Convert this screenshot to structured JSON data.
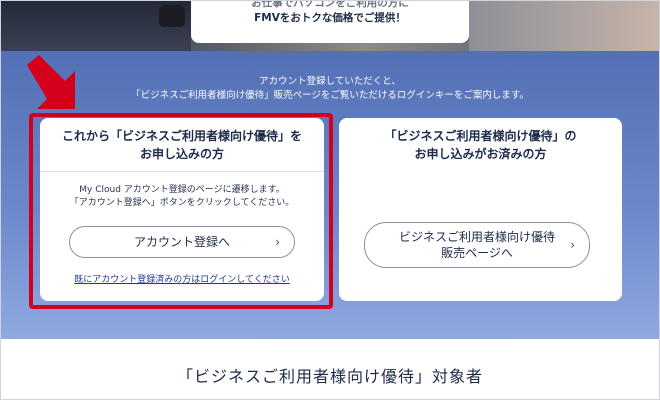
{
  "hero": {
    "line1": "お仕事でパソコンをご利用の方に",
    "line2": "FMVをおトクな価格でご提供！"
  },
  "intro": {
    "line1": "アカウント登録していただくと、",
    "line2": "「ビジネスご利用者様向け優待」販売ページをご覧いただけるログインキーをご案内します。"
  },
  "card_new": {
    "heading_line1": "これから「ビジネスご利用者様向け優待」を",
    "heading_line2": "お申し込みの方",
    "desc_line1": "My Cloud アカウント登録のページに遷移します。",
    "desc_line2": "「アカウント登録へ」ボタンをクリックしてください。",
    "button_label": "アカウント登録へ",
    "login_link": "既にアカウント登録済みの方はログインしてください"
  },
  "card_existing": {
    "heading_line1": "「ビジネスご利用者様向け優待」の",
    "heading_line2": "お申し込みがお済みの方",
    "button_line1": "ビジネスご利用者様向け優待",
    "button_line2": "販売ページへ"
  },
  "section_title": "「ビジネスご利用者様向け優待」対象者",
  "chevron": "›",
  "colors": {
    "highlight": "#d4001b",
    "panel_top": "#5370b6",
    "panel_bottom": "#8fa9e0"
  }
}
